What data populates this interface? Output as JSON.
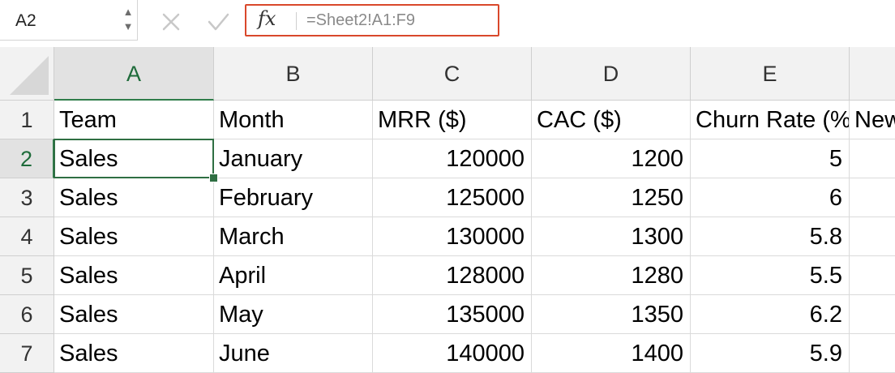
{
  "formula_bar": {
    "name_box": "A2",
    "stepper_up": "▲",
    "stepper_down": "▼",
    "fx_label": "fx",
    "formula": "=Sheet2!A1:F9"
  },
  "colors": {
    "formula_box_border": "#d9482b",
    "selection": "#2f6f43"
  },
  "icons": {
    "cancel": "close-icon",
    "confirm": "check-icon",
    "insert_function": "fx-icon"
  },
  "sheet": {
    "columns": [
      "A",
      "B",
      "C",
      "D",
      "E",
      ""
    ],
    "rows": [
      "1",
      "2",
      "3",
      "4",
      "5",
      "6",
      "7"
    ],
    "active_cell": "A2",
    "cells": [
      [
        "Team",
        "Month",
        "MRR ($)",
        "CAC ($)",
        "Churn Rate (%",
        "New"
      ],
      [
        "Sales",
        "January",
        "120000",
        "1200",
        "5",
        ""
      ],
      [
        "Sales",
        "February",
        "125000",
        "1250",
        "6",
        ""
      ],
      [
        "Sales",
        "March",
        "130000",
        "1300",
        "5.8",
        ""
      ],
      [
        "Sales",
        "April",
        "128000",
        "1280",
        "5.5",
        ""
      ],
      [
        "Sales",
        "May",
        "135000",
        "1350",
        "6.2",
        ""
      ],
      [
        "Sales",
        "June",
        "140000",
        "1400",
        "5.9",
        ""
      ]
    ]
  }
}
